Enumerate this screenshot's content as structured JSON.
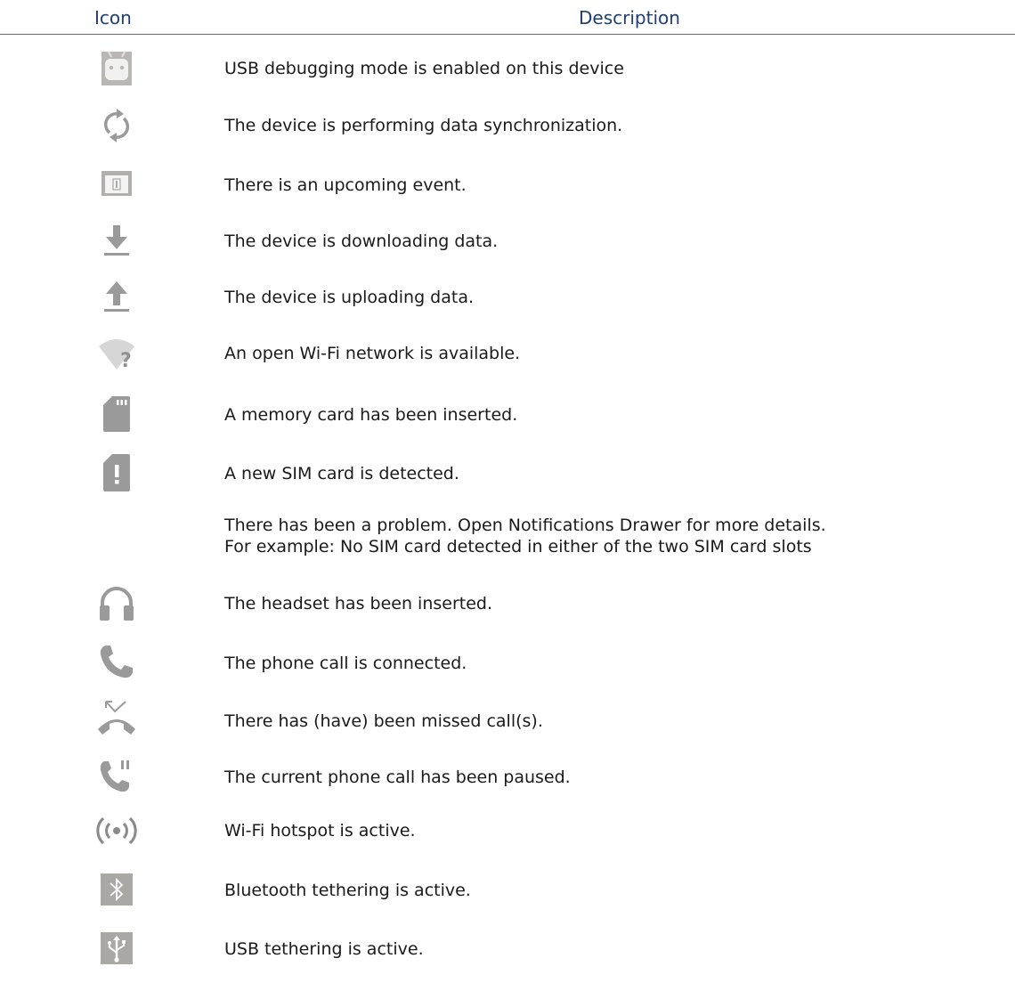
{
  "table": {
    "headers": {
      "icon": "Icon",
      "description": "Description"
    },
    "rows": [
      {
        "icon": "usb-debugging-icon",
        "description": [
          "USB debugging mode is enabled on this device"
        ]
      },
      {
        "icon": "sync-icon",
        "description": [
          "The device is performing data synchronization."
        ]
      },
      {
        "icon": "calendar-event-icon",
        "description": [
          "There is an upcoming event."
        ]
      },
      {
        "icon": "download-icon",
        "description": [
          "The device is downloading data."
        ]
      },
      {
        "icon": "upload-icon",
        "description": [
          "The device is uploading data."
        ]
      },
      {
        "icon": "open-wifi-icon",
        "description": [
          "An open Wi-Fi network is available."
        ]
      },
      {
        "icon": "memory-card-icon",
        "description": [
          "A memory card has been inserted."
        ]
      },
      {
        "icon": "sim-card-alert-icon",
        "description": [
          "A new SIM card is detected."
        ]
      },
      {
        "icon": "",
        "description": [
          "There has been a problem. Open Notifications Drawer for more details.",
          "For example: No SIM card detected in either of the two SIM card slots"
        ]
      },
      {
        "icon": "headset-icon",
        "description": [
          "The headset has been inserted."
        ]
      },
      {
        "icon": "phone-call-icon",
        "description": [
          "The phone call is connected."
        ]
      },
      {
        "icon": "missed-call-icon",
        "description": [
          "There has (have) been missed call(s)."
        ]
      },
      {
        "icon": "call-paused-icon",
        "description": [
          "The current phone call has been paused."
        ]
      },
      {
        "icon": "wifi-hotspot-icon",
        "description": [
          "Wi-Fi hotspot is active."
        ]
      },
      {
        "icon": "bluetooth-tethering-icon",
        "description": [
          "Bluetooth tethering is active."
        ]
      },
      {
        "icon": "usb-tethering-icon",
        "description": [
          "USB tethering is active."
        ]
      }
    ]
  }
}
